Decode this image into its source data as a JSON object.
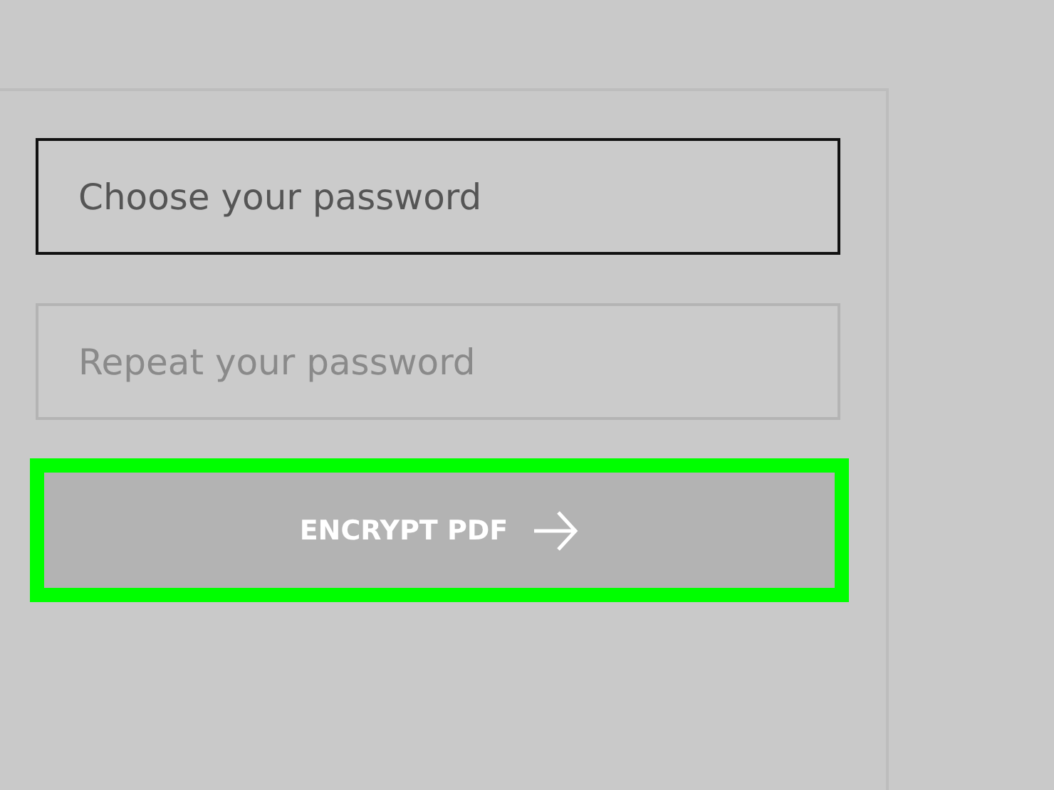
{
  "fields": [
    {
      "placeholder": "Choose your password",
      "focused": true
    },
    {
      "placeholder": "Repeat your password",
      "focused": false
    }
  ],
  "button": {
    "label": "ENCRYPT PDF",
    "highlighted": true
  }
}
